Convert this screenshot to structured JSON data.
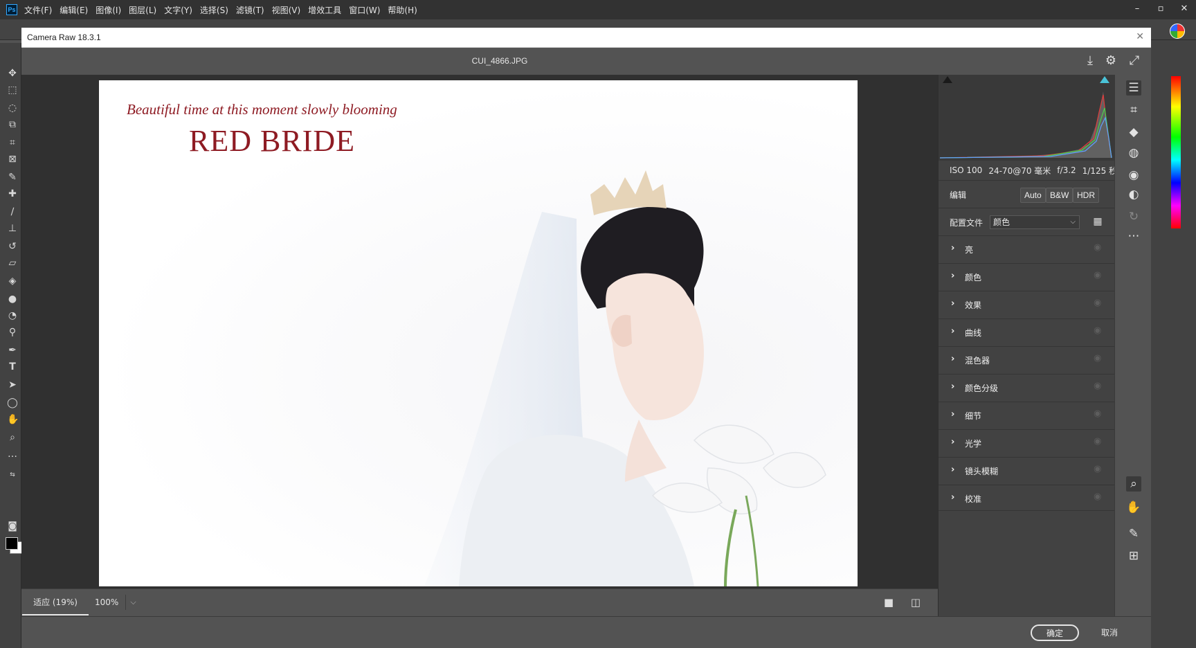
{
  "photoshop": {
    "logo": "Ps",
    "menu": [
      "文件(F)",
      "编辑(E)",
      "图像(I)",
      "图层(L)",
      "文字(Y)",
      "选择(S)",
      "滤镜(T)",
      "视图(V)",
      "增效工具",
      "窗口(W)",
      "帮助(H)"
    ],
    "window_controls": [
      "–",
      "▫",
      "✕"
    ]
  },
  "camera_raw": {
    "title": "Camera Raw 18.3.1",
    "filename": "CUI_4866.JPG",
    "photo": {
      "tagline": "Beautiful time at this moment slowly blooming",
      "brand": "RED BRIDE"
    },
    "zoom": {
      "fit_label": "适应 (19%)",
      "zoom_value": "100%"
    },
    "exif": {
      "iso": "ISO 100",
      "lens": "24-70@70 毫米",
      "aperture": "f/3.2",
      "shutter": "1/125 秒"
    },
    "edit": {
      "title": "编辑",
      "auto": "Auto",
      "bw": "B&W",
      "hdr": "HDR"
    },
    "profile": {
      "label": "配置文件",
      "value": "颜色"
    },
    "sections": [
      "亮",
      "颜色",
      "效果",
      "曲线",
      "混色器",
      "颜色分级",
      "细节",
      "光学",
      "镜头模糊",
      "校准"
    ],
    "footer": {
      "ok": "确定",
      "cancel": "取消"
    }
  }
}
